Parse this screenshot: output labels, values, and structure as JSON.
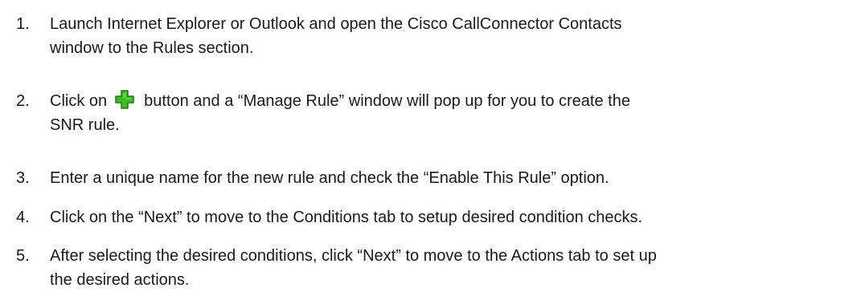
{
  "steps": [
    {
      "number": "1.",
      "lines": [
        "Launch Internet Explorer or Outlook and open the Cisco CallConnector Contacts",
        "window to the Rules section."
      ]
    },
    {
      "number": "2.",
      "before_icon": "Click on",
      "icon": "green-plus-add-icon",
      "after_icon": "button and a “Manage Rule” window will pop up for you to create the",
      "line2": "SNR rule."
    },
    {
      "number": "3.",
      "lines": [
        "Enter a unique name for the new rule and check the “Enable This Rule” option."
      ]
    },
    {
      "number": "4.",
      "lines": [
        "Click on the “Next” to move to the Conditions tab to setup desired condition checks."
      ]
    },
    {
      "number": "5.",
      "lines": [
        "After selecting the desired conditions, click “Next” to move to the Actions tab to set up",
        "the desired actions."
      ]
    }
  ],
  "colors": {
    "text": "#1a1a1a",
    "icon_fill": "#3dbb1f",
    "icon_outline": "#1d7a0c"
  }
}
